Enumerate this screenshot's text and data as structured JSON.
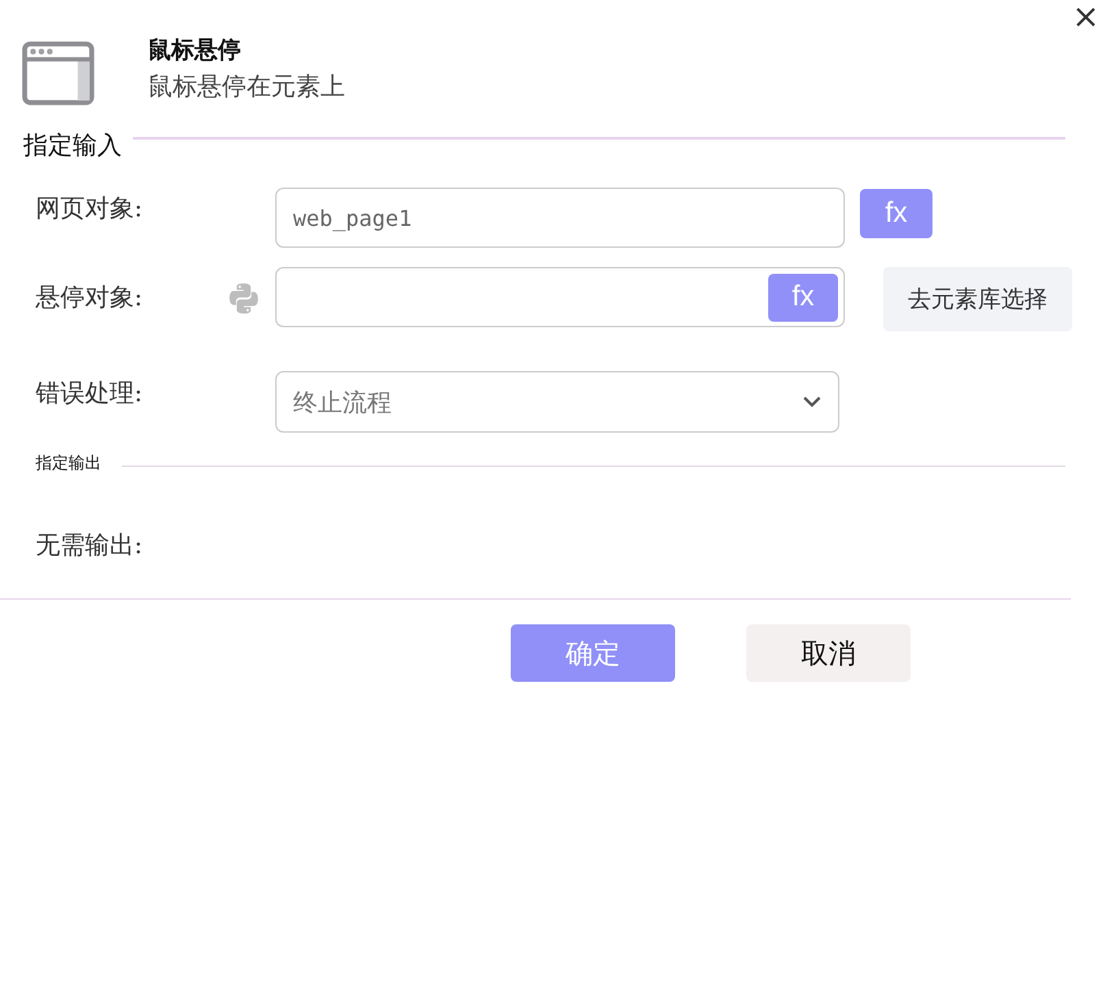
{
  "dialog": {
    "title": "鼠标悬停",
    "subtitle": "鼠标悬停在元素上",
    "close": "×"
  },
  "input_section": {
    "title": "指定输入",
    "fields": [
      {
        "kind": "text",
        "label": "网页对象:",
        "value": "web_page1",
        "fx": "fx"
      },
      {
        "kind": "element",
        "label": "悬停对象:",
        "python": true,
        "fx": "fx",
        "side_button": "去元素库选择"
      },
      {
        "kind": "select",
        "label": "错误处理:",
        "value": "终止流程"
      }
    ]
  },
  "output_section": {
    "title": "指定输出",
    "note": "无需输出:"
  },
  "buttons": [
    {
      "label": "确定",
      "kind": "primary"
    },
    {
      "label": "取消",
      "kind": "secondary"
    }
  ]
}
